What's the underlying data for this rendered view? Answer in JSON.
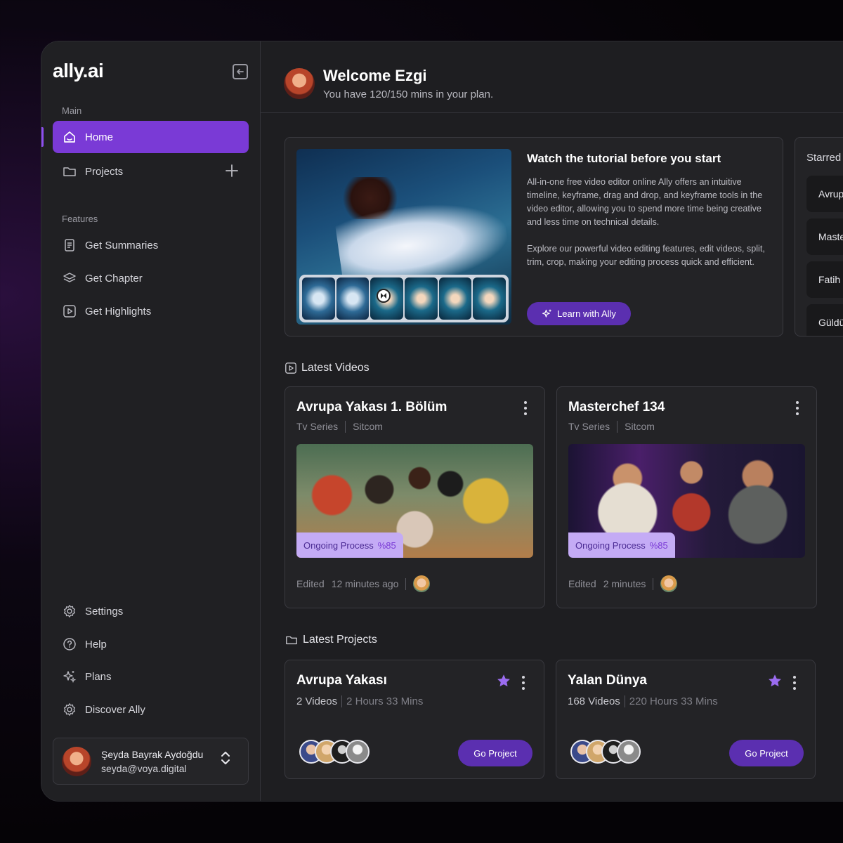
{
  "app": {
    "logo": "ally.ai"
  },
  "sidebar": {
    "main_label": "Main",
    "features_label": "Features",
    "main_items": [
      {
        "label": "Home",
        "icon": "home-icon",
        "active": true
      },
      {
        "label": "Projects",
        "icon": "folder-icon"
      }
    ],
    "feature_items": [
      {
        "label": "Get Summaries",
        "icon": "document-icon"
      },
      {
        "label": "Get Chapter",
        "icon": "layers-icon"
      },
      {
        "label": "Get Highlights",
        "icon": "play-square-icon"
      }
    ],
    "bottom_items": [
      {
        "label": "Settings",
        "icon": "gear-icon"
      },
      {
        "label": "Help",
        "icon": "help-icon"
      },
      {
        "label": "Plans",
        "icon": "sparkle-icon"
      },
      {
        "label": "Discover Ally",
        "icon": "gear-icon"
      }
    ],
    "user": {
      "name": "Şeyda Bayrak Aydoğdu",
      "email": "seyda@voya.digital"
    }
  },
  "header": {
    "welcome": "Welcome Ezgi",
    "plan": "You have 120/150 mins in your plan."
  },
  "tutorial": {
    "title": "Watch the tutorial before you start",
    "paragraph1": "All-in-one free video editor online Ally offers an intuitive timeline, keyframe, drag and drop, and keyframe tools in the video editor, allowing you to spend more time being creative and less time on technical details.",
    "paragraph2": "Explore our powerful video editing features, edit videos, split, trim, crop, making your editing process quick and efficient.",
    "button": "Learn with Ally"
  },
  "starred": {
    "title": "Starred",
    "items": [
      "Avrupa Yakası",
      "Masterchef",
      "Fatih Harbiye",
      "Güldür Güldür"
    ]
  },
  "latest_videos": {
    "title": "Latest Videos",
    "cards": [
      {
        "title": "Avrupa Yakası 1. Bölüm",
        "type": "Tv Series",
        "genre": "Sitcom",
        "progress_label": "Ongoing Process",
        "progress_value": "%85",
        "edited_label": "Edited",
        "edited_time": "12 minutes ago"
      },
      {
        "title": "Masterchef 134",
        "type": "Tv Series",
        "genre": "Sitcom",
        "progress_label": "Ongoing Process",
        "progress_value": "%85",
        "edited_label": "Edited",
        "edited_time": "2 minutes"
      }
    ]
  },
  "latest_projects": {
    "title": "Latest Projects",
    "cards": [
      {
        "title": "Avrupa Yakası",
        "videos": "2 Videos",
        "duration": "2 Hours 33 Mins",
        "button": "Go Project",
        "starred": true
      },
      {
        "title": "Yalan Dünya",
        "videos": "168 Videos",
        "duration": "220 Hours 33 Mins",
        "button": "Go Project",
        "starred": true
      }
    ]
  },
  "colors": {
    "accent": "#7a3ad6",
    "button": "#5b2fb0",
    "badge": "#c4abf5",
    "star": "#9b6cf0"
  }
}
